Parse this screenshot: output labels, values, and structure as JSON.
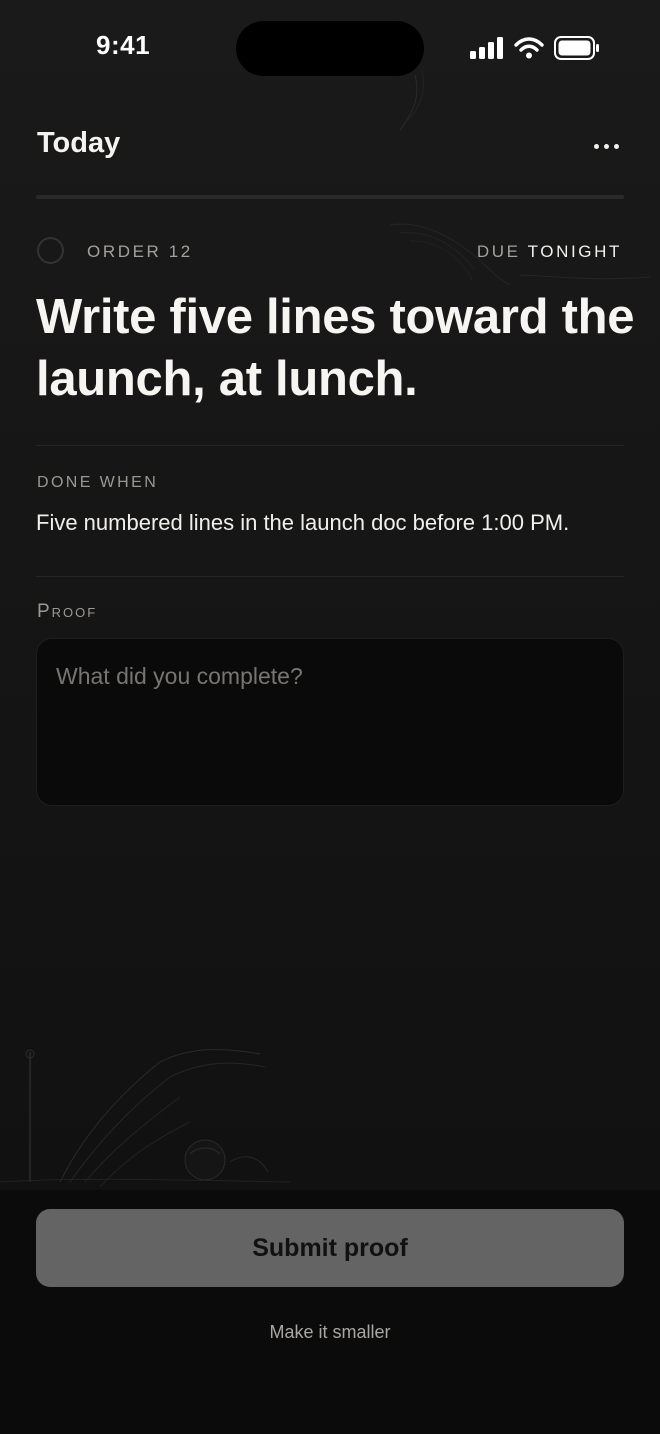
{
  "status_bar": {
    "time": "9:41",
    "icons": [
      "cellular-signal-icon",
      "wifi-icon",
      "battery-icon"
    ]
  },
  "header": {
    "title": "Today",
    "more_icon": "ellipsis-icon"
  },
  "task": {
    "order_label": "ORDER 12",
    "due_prefix": "DUE",
    "due_value": "TONIGHT",
    "title": "Write five lines toward the launch, at lunch.",
    "done_when_label": "DONE WHEN",
    "done_when_text": "Five numbered lines in the launch doc before 1:00 PM.",
    "proof_label": "Proof",
    "proof_value": "",
    "proof_placeholder": "What did you complete?"
  },
  "actions": {
    "submit_label": "Submit proof",
    "smaller_label": "Make it smaller"
  },
  "colors": {
    "background": "#151515",
    "text": "#f2f1ee",
    "muted": "#a3a19c",
    "button": "#646464"
  }
}
